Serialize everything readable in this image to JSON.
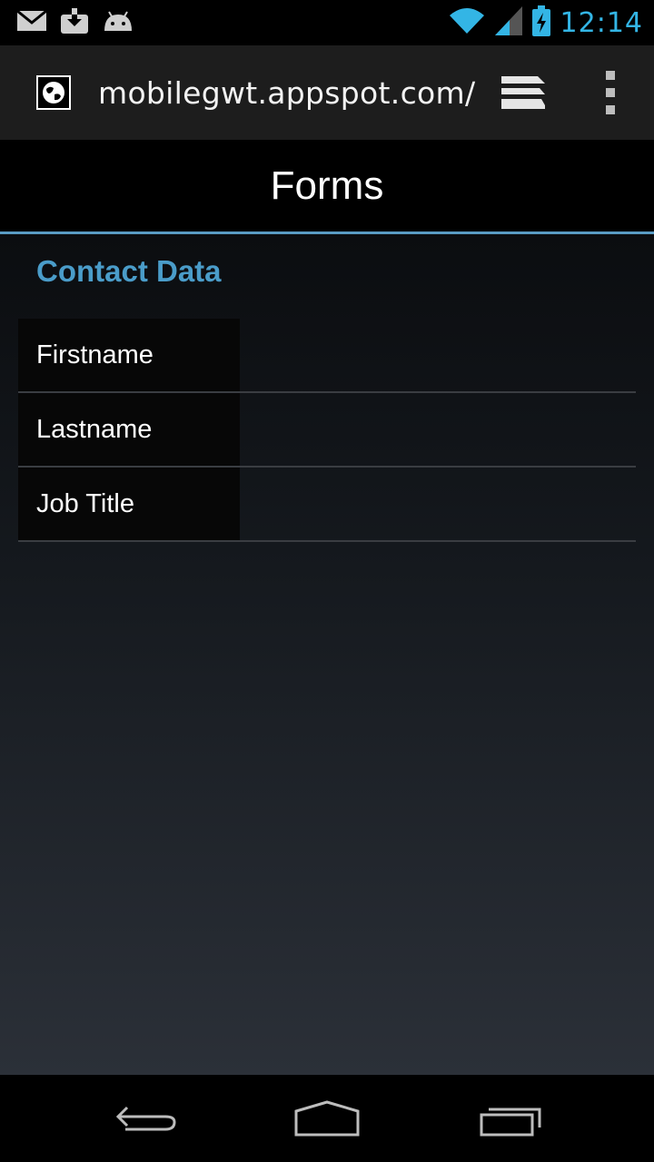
{
  "status_bar": {
    "time": "12:14",
    "left_icons": [
      "gmail-icon",
      "download-icon",
      "android-icon"
    ],
    "right_icons": [
      "wifi-icon",
      "signal-icon",
      "battery-charging-icon"
    ],
    "accent_color": "#33b5e5"
  },
  "browser": {
    "url": "mobilegwt.appspot.com/",
    "favicon": "globe-icon",
    "tabs_icon": "tabs-icon",
    "menu_icon": "overflow-menu-icon"
  },
  "header": {
    "title": "Forms",
    "accent_line_color": "#5a9cc4"
  },
  "section": {
    "title": "Contact Data",
    "title_color": "#4a9cc9"
  },
  "form": {
    "fields": [
      {
        "label": "Firstname",
        "value": ""
      },
      {
        "label": "Lastname",
        "value": ""
      },
      {
        "label": "Job Title",
        "value": ""
      }
    ]
  },
  "nav_bar": {
    "buttons": [
      "back-icon",
      "home-icon",
      "recent-apps-icon"
    ]
  }
}
